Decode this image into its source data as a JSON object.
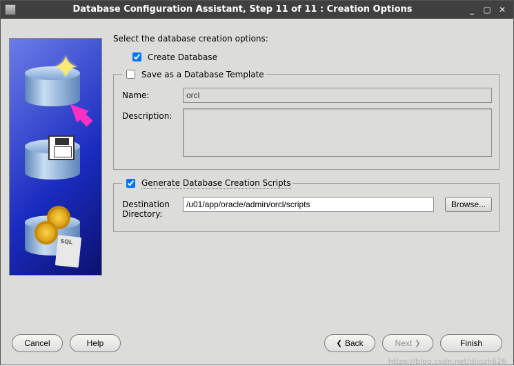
{
  "window": {
    "title": "Database Configuration Assistant, Step 11 of 11 : Creation Options"
  },
  "main": {
    "heading": "Select the database creation options:",
    "createDatabase": {
      "label": "Create Database",
      "checked": true
    },
    "saveTemplate": {
      "label": "Save as a Database Template",
      "checked": false,
      "nameLabel": "Name:",
      "nameValue": "orcl",
      "descLabel": "Description:",
      "descValue": ""
    },
    "genScripts": {
      "label": "Generate Database Creation Scripts",
      "checked": true,
      "destLabel": "Destination Directory:",
      "destValue": "/u01/app/oracle/admin/orcl/scripts",
      "browse": "Browse..."
    }
  },
  "footer": {
    "cancel": "Cancel",
    "help": "Help",
    "back": "Back",
    "next": "Next",
    "finish": "Finish"
  },
  "watermark": "https://blog.csdn.net/djjozh626"
}
